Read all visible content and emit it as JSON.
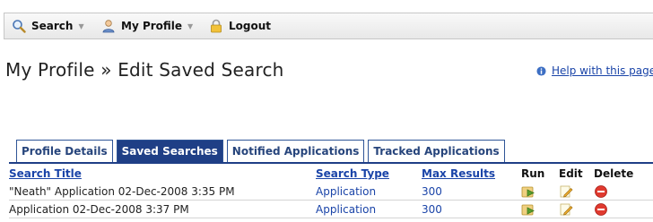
{
  "menu": {
    "search_label": "Search",
    "profile_label": "My Profile",
    "logout_label": "Logout"
  },
  "header": {
    "title": "My Profile » Edit Saved Search",
    "help_link": "Help with this page"
  },
  "tabs": [
    {
      "label": "Profile Details",
      "active": false
    },
    {
      "label": "Saved Searches",
      "active": true
    },
    {
      "label": "Notified Applications",
      "active": false
    },
    {
      "label": "Tracked Applications",
      "active": false
    }
  ],
  "table": {
    "columns": {
      "title": "Search Title",
      "type": "Search Type",
      "max": "Max Results",
      "run": "Run",
      "edit": "Edit",
      "delete": "Delete"
    },
    "rows": [
      {
        "title": "\"Neath\" Application 02-Dec-2008 3:35 PM",
        "type": "Application",
        "max": "300"
      },
      {
        "title": "Application 02-Dec-2008 3:37 PM",
        "type": "Application",
        "max": "300"
      }
    ]
  },
  "colors": {
    "tab_active": "#1f3f86",
    "link": "#1a44a8",
    "delete_icon": "#e03a2f",
    "run_icon": "#6aa33a"
  }
}
